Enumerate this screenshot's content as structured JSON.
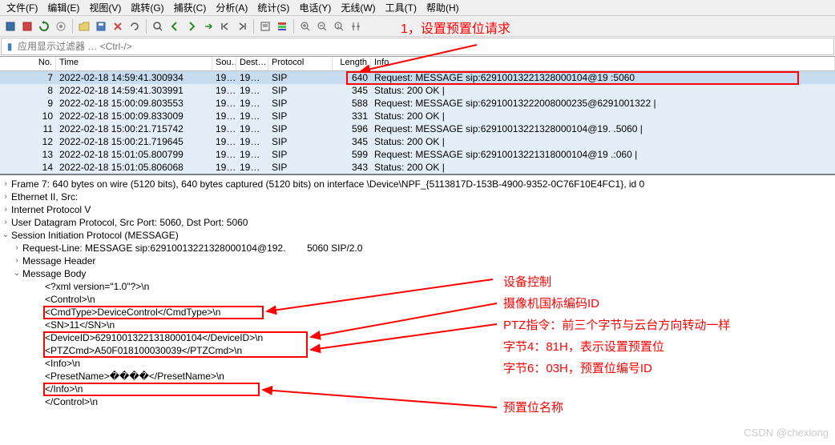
{
  "menu": {
    "file": "文件(F)",
    "edit": "编辑(E)",
    "view": "视图(V)",
    "jump": "跳转(G)",
    "capture": "捕获(C)",
    "analyze": "分析(A)",
    "stats": "统计(S)",
    "phone": "电话(Y)",
    "wireless": "无线(W)",
    "tools": "工具(T)",
    "help": "帮助(H)"
  },
  "filter": {
    "placeholder": "应用显示过滤器 … <Ctrl-/>"
  },
  "annotation1": "1，设置预置位请求",
  "headers": {
    "no": "No.",
    "time": "Time",
    "src": "Sou…",
    "dst": "Dest…",
    "proto": "Protocol",
    "len": "Length",
    "info": "Info"
  },
  "rows": [
    {
      "no": "7",
      "time": "2022-02-18 14:59:41.300934",
      "src": "19…",
      "dst": "19…",
      "proto": "SIP",
      "len": "640",
      "info": "Request: MESSAGE sip:62910013221328000104@19             :5060",
      "sel": true
    },
    {
      "no": "8",
      "time": "2022-02-18 14:59:41.303991",
      "src": "19…",
      "dst": "19…",
      "proto": "SIP",
      "len": "345",
      "info": "Status: 200 OK |"
    },
    {
      "no": "9",
      "time": "2022-02-18 15:00:09.803553",
      "src": "19…",
      "dst": "19…",
      "proto": "SIP",
      "len": "588",
      "info": "Request: MESSAGE sip:62910013222008000235@6291001322 |"
    },
    {
      "no": "10",
      "time": "2022-02-18 15:00:09.833009",
      "src": "19…",
      "dst": "19…",
      "proto": "SIP",
      "len": "331",
      "info": "Status: 200 OK |"
    },
    {
      "no": "11",
      "time": "2022-02-18 15:00:21.715742",
      "src": "19…",
      "dst": "19…",
      "proto": "SIP",
      "len": "596",
      "info": "Request: MESSAGE sip:62910013221328000104@19.            .5060 |"
    },
    {
      "no": "12",
      "time": "2022-02-18 15:00:21.719645",
      "src": "19…",
      "dst": "19…",
      "proto": "SIP",
      "len": "345",
      "info": "Status: 200 OK |"
    },
    {
      "no": "13",
      "time": "2022-02-18 15:01:05.800799",
      "src": "19…",
      "dst": "19…",
      "proto": "SIP",
      "len": "599",
      "info": "Request: MESSAGE sip:62910013221318000104@19           .:060 |"
    },
    {
      "no": "14",
      "time": "2022-02-18 15:01:05.806068",
      "src": "19…",
      "dst": "19…",
      "proto": "SIP",
      "len": "343",
      "info": "Status: 200 OK |"
    }
  ],
  "detail": {
    "frame": "Frame 7: 640 bytes on wire (5120 bits), 640 bytes captured (5120 bits) on interface \\Device\\NPF_{5113817D-153B-4900-9352-0C76F10E4FC1}, id 0",
    "eth": "Ethernet II, Src: ",
    "ip": "Internet Protocol V",
    "udp": "User Datagram Protocol, Src Port: 5060, Dst Port: 5060",
    "sip": "Session Initiation Protocol (MESSAGE)",
    "reqline": "Request-Line: MESSAGE sip:62910013221328000104@192.        5060 SIP/2.0",
    "msghdr": "Message Header",
    "msgbody": "Message Body",
    "xml": [
      "<?xml version=\"1.0\"?>\\n",
      "<Control>\\n",
      "<CmdType>DeviceControl</CmdType>\\n",
      "<SN>11</SN>\\n",
      "<DeviceID>62910013221318000104</DeviceID>\\n",
      "<PTZCmd>A50F018100030039</PTZCmd>\\n",
      "<Info>\\n",
      "<PresetName>����</PresetName>\\n",
      "</Info>\\n",
      "</Control>\\n"
    ]
  },
  "anno": {
    "a1": "设备控制",
    "a2": "摄像机国标编码ID",
    "a3": "PTZ指令：前三个字节与云台方向转动一样",
    "a4": "字节4：81H，表示设置预置位",
    "a5": "字节6：03H，预置位编号ID",
    "a6": "预置位名称"
  },
  "watermark": "CSDN @chexlong"
}
